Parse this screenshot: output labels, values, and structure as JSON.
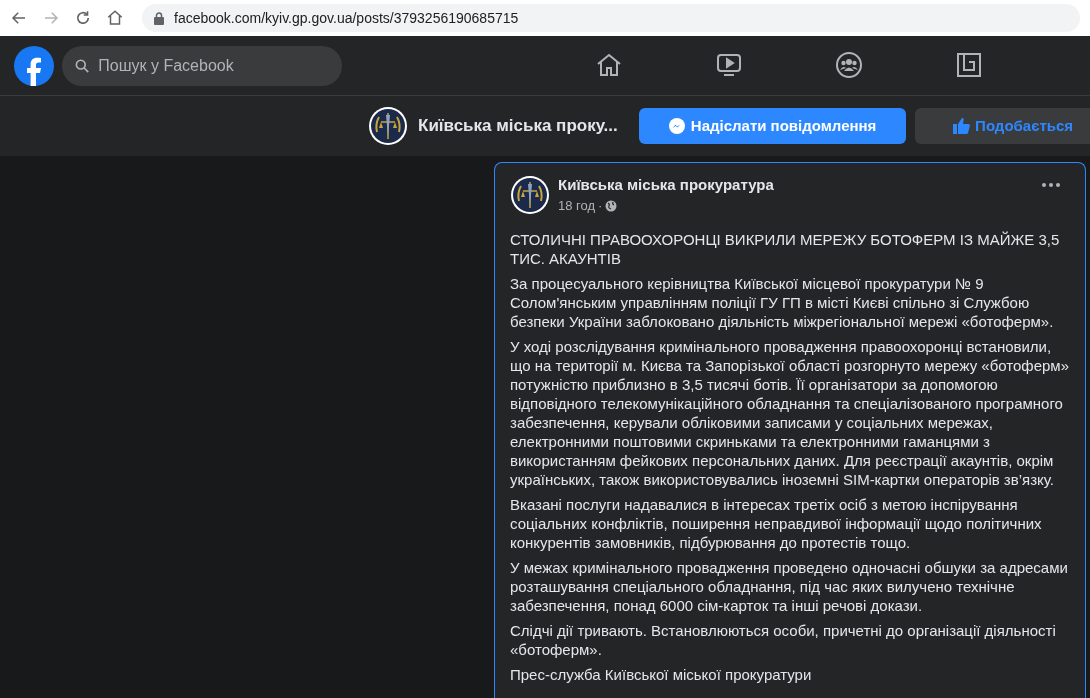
{
  "browser": {
    "url": "facebook.com/kyiv.gp.gov.ua/posts/3793256190685715",
    "forward_disabled": true
  },
  "topbar": {
    "search": {
      "placeholder": "Пошук у Facebook"
    }
  },
  "page_header": {
    "name": "Київська міська проку...",
    "message_button": "Надіслати повідомлення",
    "like_button": "Подобається"
  },
  "post": {
    "author": "Київська міська прокуратура",
    "time": "18 год",
    "separator": "·",
    "paragraphs": [
      "СТОЛИЧНІ ПРАВООХОРОНЦІ ВИКРИЛИ МЕРЕЖУ БОТОФЕРМ ІЗ МАЙЖЕ 3,5 ТИС. АКАУНТІВ",
      "За процесуального керівництва Київської місцевої прокуратури № 9 Солом'янським управлінням поліції ГУ ГП в місті Києві спільно зі Службою безпеки України заблоковано діяльність міжрегіональної мережі «ботоферм».",
      "У ході розслідування кримінального провадження правоохоронці встановили, що на території м. Києва та Запорізької області розгорнуто мережу «ботоферм» потужністю приблизно в 3,5 тисячі ботів. Її організатори за допомогою відповідного телекомунікаційного обладнання та спеціалізованого програмного забезпечення, керували обліковими записами у соціальних мережах, електронними поштовими скриньками та електронними гаманцями з використанням фейкових персональних даних. Для реєстрації акаунтів, окрім українських, також використовувались іноземні SIM-картки операторів зв’язку.",
      "Вказані послуги надавалися в інтересах третіх осіб з метою інспірування соціальних конфліктів, поширення неправдивої інформації щодо політичних конкурентів замовників, підбурювання до протестів тощо.",
      "У межах кримінального провадження проведено одночасні обшуки за адресами розташування спеціального обладнання, під час яких вилучено технічне забезпечення, понад 6000 сім-карток та інші речові докази.",
      "Слідчі дії тривають. Встановлюються особи, причетні до організації діяльності «ботоферм».",
      "Прес-служба Київської міської прокуратури"
    ]
  }
}
